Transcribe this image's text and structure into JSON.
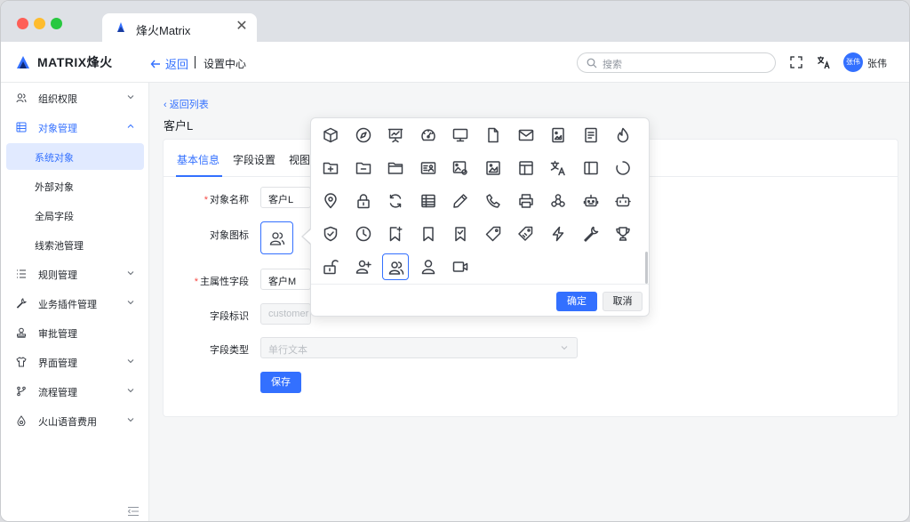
{
  "browser": {
    "tab_title": "烽火Matrix",
    "close_glyph": "✕"
  },
  "header": {
    "brand": "MATRIX烽火",
    "back_label": "返回",
    "breadcrumb": "设置中心",
    "search_placeholder": "搜索",
    "avatar_text": "张伟",
    "username": "张伟"
  },
  "sidebar": {
    "items": [
      {
        "label": "组织权限",
        "icon": "users-icon",
        "expandable": true
      },
      {
        "label": "对象管理",
        "icon": "table-icon",
        "expandable": true,
        "expanded": true
      },
      {
        "label": "规则管理",
        "icon": "list-icon",
        "expandable": true
      },
      {
        "label": "业务插件管理",
        "icon": "wrench-icon",
        "expandable": true
      },
      {
        "label": "审批管理",
        "icon": "stamp-icon",
        "expandable": false
      },
      {
        "label": "界面管理",
        "icon": "shirt-icon",
        "expandable": true
      },
      {
        "label": "流程管理",
        "icon": "branch-icon",
        "expandable": true
      },
      {
        "label": "火山语音费用",
        "icon": "drop-icon",
        "expandable": true
      }
    ],
    "subitems": [
      {
        "label": "系统对象",
        "selected": true
      },
      {
        "label": "外部对象"
      },
      {
        "label": "全局字段"
      },
      {
        "label": "线索池管理"
      }
    ]
  },
  "content": {
    "back_list": "返回列表",
    "page_title": "客户L",
    "tabs": [
      "基本信息",
      "字段设置",
      "视图"
    ],
    "form": {
      "object_name_label": "对象名称",
      "object_name_value": "客户L",
      "object_icon_label": "对象图标",
      "primary_field_label": "主属性字段",
      "primary_field_value": "客户M",
      "field_id_label": "字段标识",
      "field_id_placeholder": "customer",
      "field_type_label": "字段类型",
      "field_type_placeholder": "单行文本",
      "save_label": "保存",
      "required_mark": "*"
    }
  },
  "icon_picker": {
    "icons": [
      "cube-icon",
      "compass-icon",
      "presentation-icon",
      "dashboard-icon",
      "monitor-icon",
      "file-icon",
      "mail-icon",
      "image-file-icon",
      "document-icon",
      "fire-icon",
      "folder-add-icon",
      "folder-minus-icon",
      "folder-icon",
      "contact-card-icon",
      "image-setting-icon",
      "picture-icon",
      "layout-icon",
      "translate-icon",
      "sidebar-layout-icon",
      "loading-icon",
      "location-icon",
      "lock-icon",
      "refresh-icon",
      "table-icon",
      "pen-icon",
      "phone-icon",
      "printer-icon",
      "nodes-icon",
      "robot-icon",
      "bot-icon",
      "shield-check-icon",
      "clock-icon",
      "bookmark-add-icon",
      "bookmark-icon",
      "bookmark-check-icon",
      "tag-icon",
      "tags-icon",
      "lightning-icon",
      "wrench-icon",
      "trophy-icon",
      "unlock-icon",
      "user-add-icon",
      "users-icon",
      "user-icon",
      "video-icon"
    ],
    "selected": "users-icon",
    "ok_label": "确定",
    "cancel_label": "取消"
  },
  "colors": {
    "accent": "#3370ff",
    "required": "#f54a45",
    "selected_bg": "#e1eaff"
  }
}
